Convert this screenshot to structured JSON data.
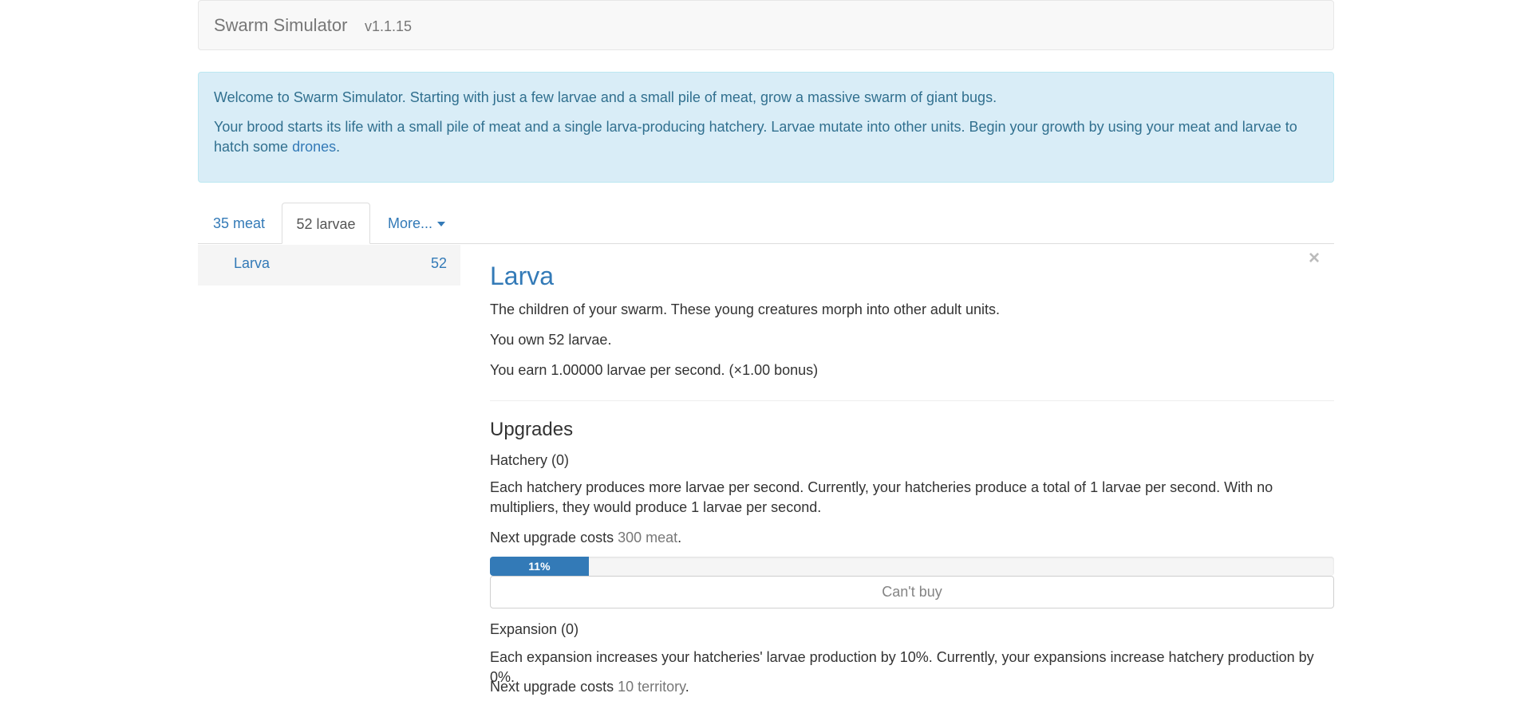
{
  "navbar": {
    "brand": "Swarm Simulator",
    "version": "v1.1.15"
  },
  "welcome": {
    "line1": "Welcome to Swarm Simulator. Starting with just a few larvae and a small pile of meat, grow a massive swarm of giant bugs.",
    "line2_text": "Your brood starts its life with a small pile of meat and a single larva-producing hatchery. Larvae mutate into other units. Begin your growth by using your meat and larvae to hatch some ",
    "line2_link": "drones",
    "line2_end": "."
  },
  "tabs": {
    "meat": "35 meat",
    "larvae": "52 larvae",
    "more": "More..."
  },
  "sidebar": {
    "items": [
      {
        "label": "Larva",
        "count": "52"
      }
    ]
  },
  "unit": {
    "close": "×",
    "title": "Larva",
    "description": "The children of your swarm. These young creatures morph into other adult units.",
    "owned": "You own 52 larvae.",
    "earn": "You earn 1.00000 larvae per second. (×1.00 bonus)"
  },
  "upgrades": {
    "heading": "Upgrades",
    "hatchery": {
      "title": "Hatchery (0)",
      "description": "Each hatchery produces more larvae per second. Currently, your hatcheries produce a total of 1 larvae per second. With no multipliers, they would produce 1 larvae per second.",
      "cost_prefix": "Next upgrade costs ",
      "cost_value": "300 meat",
      "cost_suffix": ".",
      "progress_label": "11%",
      "progress_percent": 11.7,
      "button_label": "Can't buy"
    },
    "expansion": {
      "title": "Expansion (0)",
      "description": "Each expansion increases your hatcheries' larvae production by 10%. Currently, your expansions increase hatchery production by 0%.",
      "cost_prefix": "Next upgrade costs ",
      "cost_value": "10 territory",
      "cost_suffix": "."
    }
  },
  "colors": {
    "link": "#337ab7",
    "alert_bg": "#d9edf7",
    "alert_text": "#31708f",
    "progress": "#337ab7"
  }
}
